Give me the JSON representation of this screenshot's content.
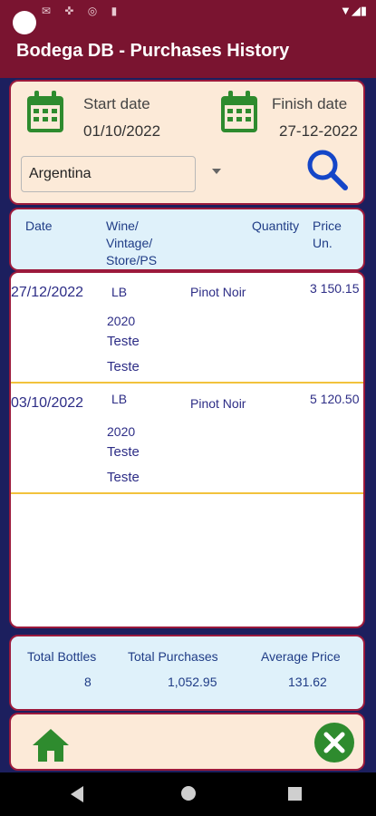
{
  "app_bar": {
    "title": "Bodega DB - Purchases History"
  },
  "filters": {
    "start_label": "Start date",
    "start_value": "01/10/2022",
    "finish_label": "Finish date",
    "finish_value": "27-12-2022",
    "country": "Argentina"
  },
  "table": {
    "headers": {
      "date": "Date",
      "wine": "Wine/\nVintage/\nStore/PS",
      "quantity": "Quantity",
      "price": "Price Un."
    },
    "rows": [
      {
        "date": "27/12/2022",
        "wine": "LB",
        "grape": "Pinot Noir",
        "price": "3 150.15",
        "vintage": "2020",
        "store": "Teste",
        "ps": "Teste"
      },
      {
        "date": "03/10/2022",
        "wine": "LB",
        "grape": "Pinot Noir",
        "price": "5 120.50",
        "vintage": "2020",
        "store": "Teste",
        "ps": "Teste"
      }
    ]
  },
  "totals": {
    "bottles_label": "Total Bottles",
    "bottles_value": "8",
    "purchases_label": "Total Purchases",
    "purchases_value": "1,052.95",
    "avg_label": "Average Price",
    "avg_value": "131.62"
  },
  "colors": {
    "app_bar": "#7a1430",
    "background": "#1c1f5e",
    "filter_panel": "#fcead8",
    "table_header": "#dff1fa",
    "row_divider": "#f2c23c",
    "icon_green": "#2e8b2e",
    "search_blue": "#1446c8"
  },
  "icons": [
    "calendar-icon",
    "search-icon",
    "home-icon",
    "close-icon",
    "dropdown-caret-icon"
  ]
}
